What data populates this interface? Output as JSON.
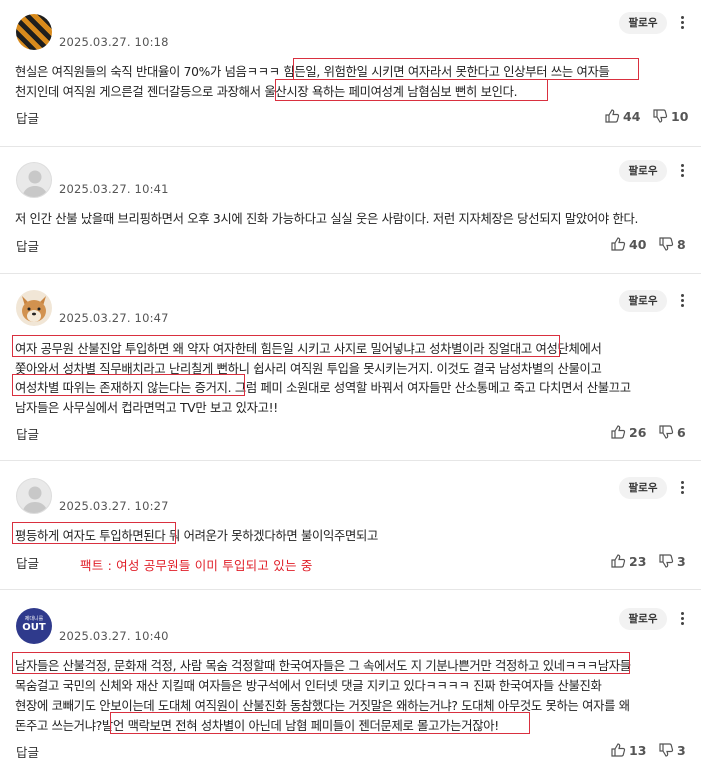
{
  "common": {
    "follow_label": "팔로우",
    "reply_label": "답글"
  },
  "comments": [
    {
      "avatar": "striped-pattern-avatar",
      "date": "2025.03.27. 10:18",
      "lines": [
        "현실은 여직원들의 숙직 반대율이 70%가 넘음ㅋㅋㅋ 힘든일, 위험한일 시키면 여자라서 못한다고 인상부터 쓰는 여자들",
        "천지인데 여직원 게으른걸 젠더갈등으로 과장해서 울산시장 욕하는 페미여성계 남혐심보 뻔히 보인다."
      ],
      "likes": "44",
      "dislikes": "10"
    },
    {
      "avatar": "default-user-avatar",
      "date": "2025.03.27. 10:41",
      "lines": [
        "저 인간 산불 났을때 브리핑하면서 오후 3시에 진화 가능하다고 실실 웃은 사람이다. 저런 지자체장은 당선되지 말았어야 한다."
      ],
      "likes": "40",
      "dislikes": "8"
    },
    {
      "avatar": "shiba-dog-avatar",
      "date": "2025.03.27. 10:47",
      "lines": [
        "여자 공무원 산불진압 투입하면 왜 약자 여자한테 힘든일 시키고 사지로 밀어넣냐고 성차별이라 징얼대고 여성단체에서",
        "쫓아와서 성차별 직무배치라고 난리칠게 뻔하니 쉽사리 여직원 투입을 못시키는거지. 이것도 결국 남성차별의 산물이고",
        "여성차별 따위는 존재하지 않는다는 증거지. 그럼 페미 소원대로 성역할 바꿔서 여자들만 산소통메고 죽고 다치면서 산불끄고",
        "남자들은 사무실에서 컵라면먹고 TV만 보고 있자고!!"
      ],
      "likes": "26",
      "dislikes": "6"
    },
    {
      "avatar": "default-user-avatar",
      "date": "2025.03.27. 10:27",
      "lines": [
        "평등하게 여자도 투입하면된다  뭐 어려운가 못하겠다하면 불이익주면되고"
      ],
      "note": "팩트 : 여성 공무원들 이미 투입되고 있는 중",
      "likes": "23",
      "dislikes": "3"
    },
    {
      "avatar": "out-badge-avatar",
      "avatar_text": "OUT",
      "avatar_small_text": "제대니를",
      "date": "2025.03.27. 10:40",
      "lines": [
        "남자들은 산불걱정, 문화재 걱정, 사람 목숨 걱정할때 한국여자들은 그 속에서도 지 기분나쁜거만 걱정하고 있네ㅋㅋㅋ남자들",
        "목숨걸고 국민의 신체와 재산 지킬때 여자들은 방구석에서 인터넷 댓글 지키고 있다ㅋㅋㅋㅋ 진짜 한국여자들 산불진화",
        "현장에 코빼기도 안보이는데 도대체 여직원이 산불진화 동참했다는 거짓말은 왜하는거냐? 도대체 아무것도 못하는 여자를 왜",
        "돈주고 쓰는거냐?발언 맥락보면 전혀 성차별이 아닌데 남혐 페미들이 젠더문제로 몰고가는거잖아!"
      ],
      "likes": "13",
      "dislikes": "3"
    }
  ],
  "colors": {
    "highlight": "#d9303f",
    "note": "#e0202a",
    "follow_bg": "#f2f2f2"
  }
}
